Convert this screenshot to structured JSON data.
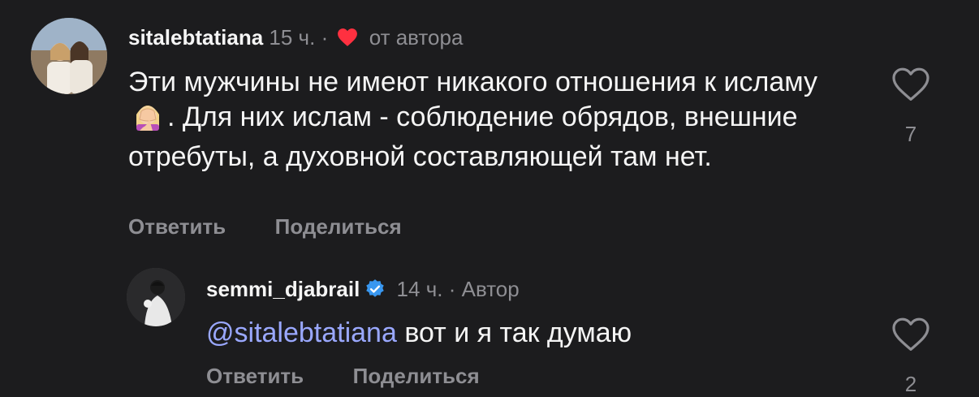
{
  "comments": [
    {
      "username": "sitalebtatiana",
      "time": "15 ч.",
      "separator": "·",
      "liked_by_author_label": "от автора",
      "text_before_emoji": "Эти мужчины не имеют никакого отношения к исламу",
      "emoji": "face-palm-woman",
      "text_after_emoji": ". Для них ислам - соблюдение обрядов, внешние отребуты, а духовной составляющей там нет.",
      "reply_label": "Ответить",
      "share_label": "Поделиться",
      "like_count": "7"
    },
    {
      "username": "semmi_djabrail",
      "verified": true,
      "time": "14 ч.",
      "separator": "·",
      "author_label": "Автор",
      "mention": "@sitalebtatiana",
      "text": "вот и я так думаю",
      "reply_label": "Ответить",
      "share_label": "Поделиться",
      "like_count": "2"
    }
  ],
  "colors": {
    "background": "#1c1c1e",
    "primary_text": "#f5f5f5",
    "secondary_text": "#8e8e93",
    "mention": "#9aa8ff",
    "heart_red": "#ff3040",
    "verified_blue": "#3897f0"
  },
  "icons": {
    "heart_small": "heart-filled-icon",
    "verified": "verified-badge-icon",
    "like": "heart-outline-icon"
  }
}
